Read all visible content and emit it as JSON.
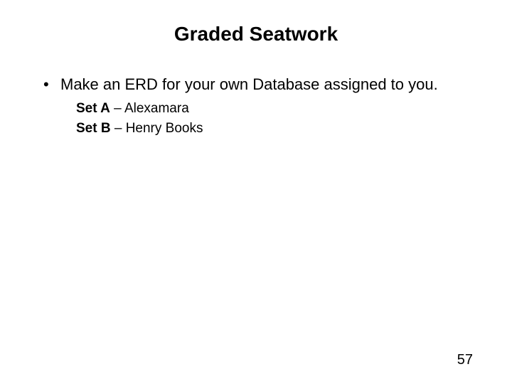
{
  "title": "Graded Seatwork",
  "bullet": "Make an ERD for your own Database assigned to you.",
  "sets": [
    {
      "label": "Set A",
      "value": " – Alexamara"
    },
    {
      "label": "Set B",
      "value": " – Henry Books"
    }
  ],
  "page_number": "57"
}
